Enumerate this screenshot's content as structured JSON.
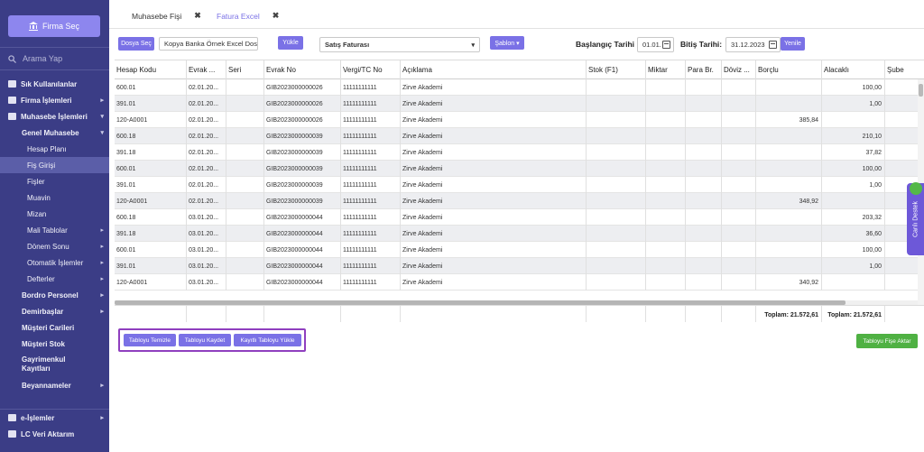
{
  "sidebar": {
    "firma_button": "Firma Seç",
    "search_placeholder": "Arama Yap",
    "items": [
      {
        "label": "Sık Kullanılanlar",
        "level": 0,
        "arrow": ""
      },
      {
        "label": "Firma İşlemleri",
        "level": 0,
        "arrow": "▸"
      },
      {
        "label": "Muhasebe İşlemleri",
        "level": 0,
        "arrow": "▾"
      },
      {
        "label": "Genel Muhasebe",
        "level": 1,
        "arrow": "▾"
      },
      {
        "label": "Hesap Planı",
        "level": 2,
        "arrow": ""
      },
      {
        "label": "Fiş Girişi",
        "level": 2,
        "arrow": "",
        "active": true
      },
      {
        "label": "Fişler",
        "level": 2,
        "arrow": ""
      },
      {
        "label": "Muavin",
        "level": 2,
        "arrow": ""
      },
      {
        "label": "Mizan",
        "level": 2,
        "arrow": ""
      },
      {
        "label": "Mali Tablolar",
        "level": 2,
        "arrow": "▸"
      },
      {
        "label": "Dönem Sonu",
        "level": 2,
        "arrow": "▸"
      },
      {
        "label": "Otomatik İşlemler",
        "level": 2,
        "arrow": "▸"
      },
      {
        "label": "Defterler",
        "level": 2,
        "arrow": "▸"
      },
      {
        "label": "Bordro Personel",
        "level": 1,
        "arrow": "▸"
      },
      {
        "label": "Demirbaşlar",
        "level": 1,
        "arrow": "▸"
      },
      {
        "label": "Müşteri Carileri",
        "level": 1,
        "arrow": ""
      },
      {
        "label": "Müşteri Stok",
        "level": 1,
        "arrow": ""
      },
      {
        "label": "Gayrimenkul Kayıtları",
        "level": 1,
        "arrow": "",
        "twoline": true
      },
      {
        "label": "Beyannameler",
        "level": 1,
        "arrow": "▸"
      }
    ],
    "bottom_items": [
      {
        "label": "e-İşlemler",
        "arrow": "▸"
      },
      {
        "label": "LC Veri Aktarım",
        "arrow": ""
      }
    ]
  },
  "tabs": [
    {
      "label": "Muhasebe Fişi",
      "close": "✖"
    },
    {
      "label": "Fatura Excel",
      "close": "✖"
    }
  ],
  "toolbar": {
    "dosya_sec": "Dosya Seç",
    "file_name": "Kopya Banka Örnek Excel Dos",
    "yukle": "Yükle",
    "fis_turu": "Satış Faturası",
    "sablon": "Şablon ▾",
    "baslangic_label": "Başlangıç Tarihi",
    "baslangic_value": "01.01.",
    "bitis_label": "Bitiş Tarihi:",
    "bitis_value": "31.12.2023",
    "yenile": "Yenile"
  },
  "grid": {
    "columns": [
      "Hesap Kodu",
      "Evrak ...",
      "Seri",
      "Evrak No",
      "Vergi/TC No",
      "Açıklama",
      "Stok (F1)",
      "Miktar",
      "Para Br.",
      "Döviz ...",
      "Borçlu",
      "Alacaklı",
      "Şube"
    ],
    "rows": [
      [
        "600.01",
        "02.01.20...",
        "",
        "GIB2023000000026",
        "11111111111",
        "Zirve Akademi",
        "",
        "",
        "",
        "",
        "",
        "100,00",
        ""
      ],
      [
        "391.01",
        "02.01.20...",
        "",
        "GIB2023000000026",
        "11111111111",
        "Zirve Akademi",
        "",
        "",
        "",
        "",
        "",
        "1,00",
        ""
      ],
      [
        "120-A0001",
        "02.01.20...",
        "",
        "GIB2023000000026",
        "11111111111",
        "Zirve Akademi",
        "",
        "",
        "",
        "",
        "385,84",
        "",
        ""
      ],
      [
        "600.18",
        "02.01.20...",
        "",
        "GIB2023000000039",
        "11111111111",
        "Zirve Akademi",
        "",
        "",
        "",
        "",
        "",
        "210,10",
        ""
      ],
      [
        "391.18",
        "02.01.20...",
        "",
        "GIB2023000000039",
        "11111111111",
        "Zirve Akademi",
        "",
        "",
        "",
        "",
        "",
        "37,82",
        ""
      ],
      [
        "600.01",
        "02.01.20...",
        "",
        "GIB2023000000039",
        "11111111111",
        "Zirve Akademi",
        "",
        "",
        "",
        "",
        "",
        "100,00",
        ""
      ],
      [
        "391.01",
        "02.01.20...",
        "",
        "GIB2023000000039",
        "11111111111",
        "Zirve Akademi",
        "",
        "",
        "",
        "",
        "",
        "1,00",
        ""
      ],
      [
        "120-A0001",
        "02.01.20...",
        "",
        "GIB2023000000039",
        "11111111111",
        "Zirve Akademi",
        "",
        "",
        "",
        "",
        "348,92",
        "",
        ""
      ],
      [
        "600.18",
        "03.01.20...",
        "",
        "GIB2023000000044",
        "11111111111",
        "Zirve Akademi",
        "",
        "",
        "",
        "",
        "",
        "203,32",
        ""
      ],
      [
        "391.18",
        "03.01.20...",
        "",
        "GIB2023000000044",
        "11111111111",
        "Zirve Akademi",
        "",
        "",
        "",
        "",
        "",
        "36,60",
        ""
      ],
      [
        "600.01",
        "03.01.20...",
        "",
        "GIB2023000000044",
        "11111111111",
        "Zirve Akademi",
        "",
        "",
        "",
        "",
        "",
        "100,00",
        ""
      ],
      [
        "391.01",
        "03.01.20...",
        "",
        "GIB2023000000044",
        "11111111111",
        "Zirve Akademi",
        "",
        "",
        "",
        "",
        "",
        "1,00",
        ""
      ],
      [
        "120-A0001",
        "03.01.20...",
        "",
        "GIB2023000000044",
        "11111111111",
        "Zirve Akademi",
        "",
        "",
        "",
        "",
        "340,92",
        "",
        ""
      ]
    ],
    "total_borclu": "Toplam: 21.572,61",
    "total_alacakli": "Toplam: 21.572,61"
  },
  "actions": {
    "tabloyu_temizle": "Tabloyu Temizle",
    "tabloyu_kaydet": "Tabloyu Kaydet",
    "kayitli_tabloyu_yukle": "Kayıtlı Tabloyu Yükle",
    "tabloyu_fise_aktar": "Tabloyu Fişe Aktar"
  },
  "side_tab": "Canlı Destek",
  "colors": {
    "sidebar_bg": "#3b3d86",
    "accent": "#7a71e6",
    "success": "#4fb143",
    "highlight_border": "#8f3fbf"
  }
}
